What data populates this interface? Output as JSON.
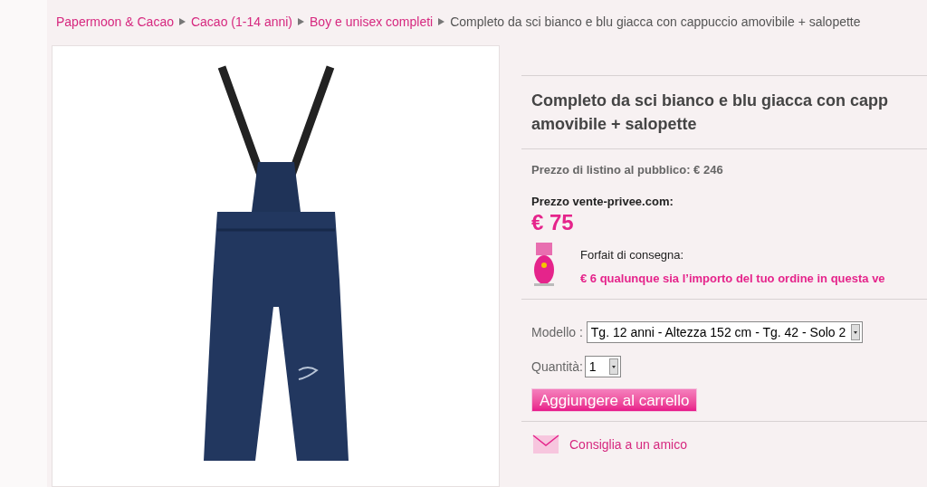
{
  "breadcrumb": [
    {
      "label": "Papermoon & Cacao",
      "link": true
    },
    {
      "label": "Cacao (1-14 anni)",
      "link": true
    },
    {
      "label": "Boy e unisex completi",
      "link": true
    },
    {
      "label": "Completo da sci bianco e blu giacca con cappuccio amovibile + salopette",
      "link": false
    }
  ],
  "product": {
    "title_lines": [
      "Completo da sci bianco e blu giacca con capp",
      "amovibile + salopette"
    ],
    "list_price": "Prezzo di listino al pubblico: € 246",
    "sale_label": "Prezzo vente-privee.com:",
    "sale_price": "€ 75",
    "shipping_label": "Forfait di consegna:",
    "shipping_text": "€ 6 qualunque sia l’importo del tuo ordine in questa ve",
    "model_label": "Modello :",
    "model_value": "Tg. 12 anni - Altezza 152 cm - Tg. 42 - Solo 2",
    "quantity_label": "Quantità:",
    "quantity_value": "1",
    "add_to_cart": "Aggiungere al carrello",
    "recommend": "Consiglia a un amico"
  }
}
